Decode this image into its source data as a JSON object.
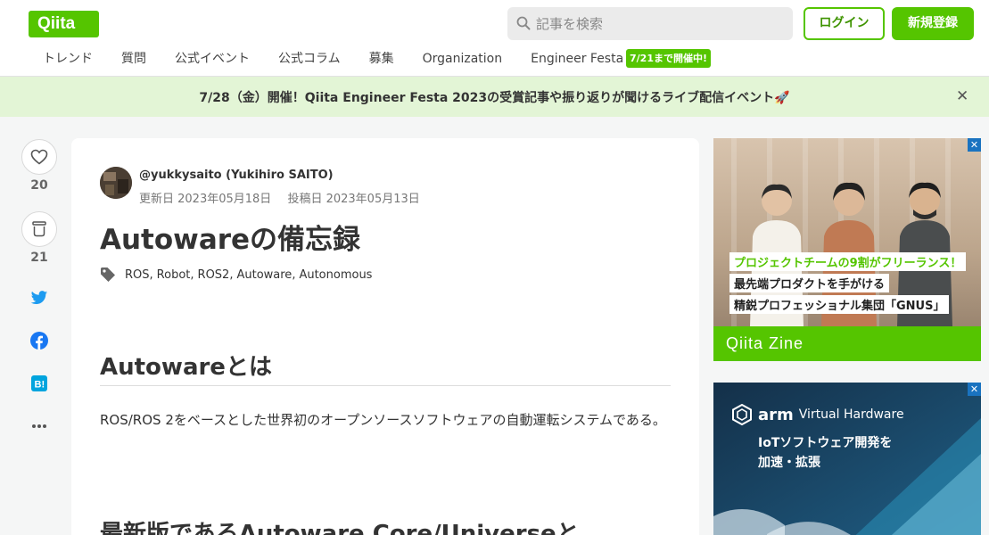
{
  "header": {
    "logo": "Qiita",
    "search_placeholder": "記事を検索",
    "login_label": "ログイン",
    "signup_label": "新規登録",
    "nav": [
      "トレンド",
      "質問",
      "公式イベント",
      "公式コラム",
      "募集",
      "Organization",
      "Engineer Festa"
    ],
    "nav_badge": "7/21まで開催中!"
  },
  "banner": {
    "text": "7/28（金）開催！Qiita Engineer Festa 2023の受賞記事や振り返りが聞けるライブ配信イベント🚀",
    "close": "✕"
  },
  "sidebar": {
    "like_count": "20",
    "stock_count": "21",
    "share_icons": [
      "twitter-icon",
      "facebook-icon",
      "hatena-bookmark-icon",
      "more-icon"
    ]
  },
  "article": {
    "author": "@yukkysaito (Yukihiro SAITO)",
    "updated": "更新日 2023年05月18日",
    "posted": "投稿日 2023年05月13日",
    "title": "Autowareの備忘録",
    "tags": [
      "ROS",
      "Robot",
      "ROS2",
      "Autoware",
      "Autonomous"
    ],
    "section1_heading": "Autowareとは",
    "section1_text": "ROS/ROS 2をベースとした世界初のオープンソースソフトウェアの自動運転システムである。",
    "section2_heading": "最新版であるAutoware Core/Universeと"
  },
  "ads": {
    "ad1_line1": "プロジェクトチームの9割がフリーランス！",
    "ad1_line2": "最先端プロダクトを手がける",
    "ad1_line3": "精鋭プロフェッショナル集団「GNUS」",
    "ad1_footer": "Qiita Zine",
    "ad2_brand": "arm",
    "ad2_product": "Virtual Hardware",
    "ad2_line1": "IoTソフトウェア開発を",
    "ad2_line2": "加速・拡張",
    "ad_mark": "✕"
  },
  "colors": {
    "brand_green": "#55c500",
    "banner_bg": "#e3f5d6"
  }
}
